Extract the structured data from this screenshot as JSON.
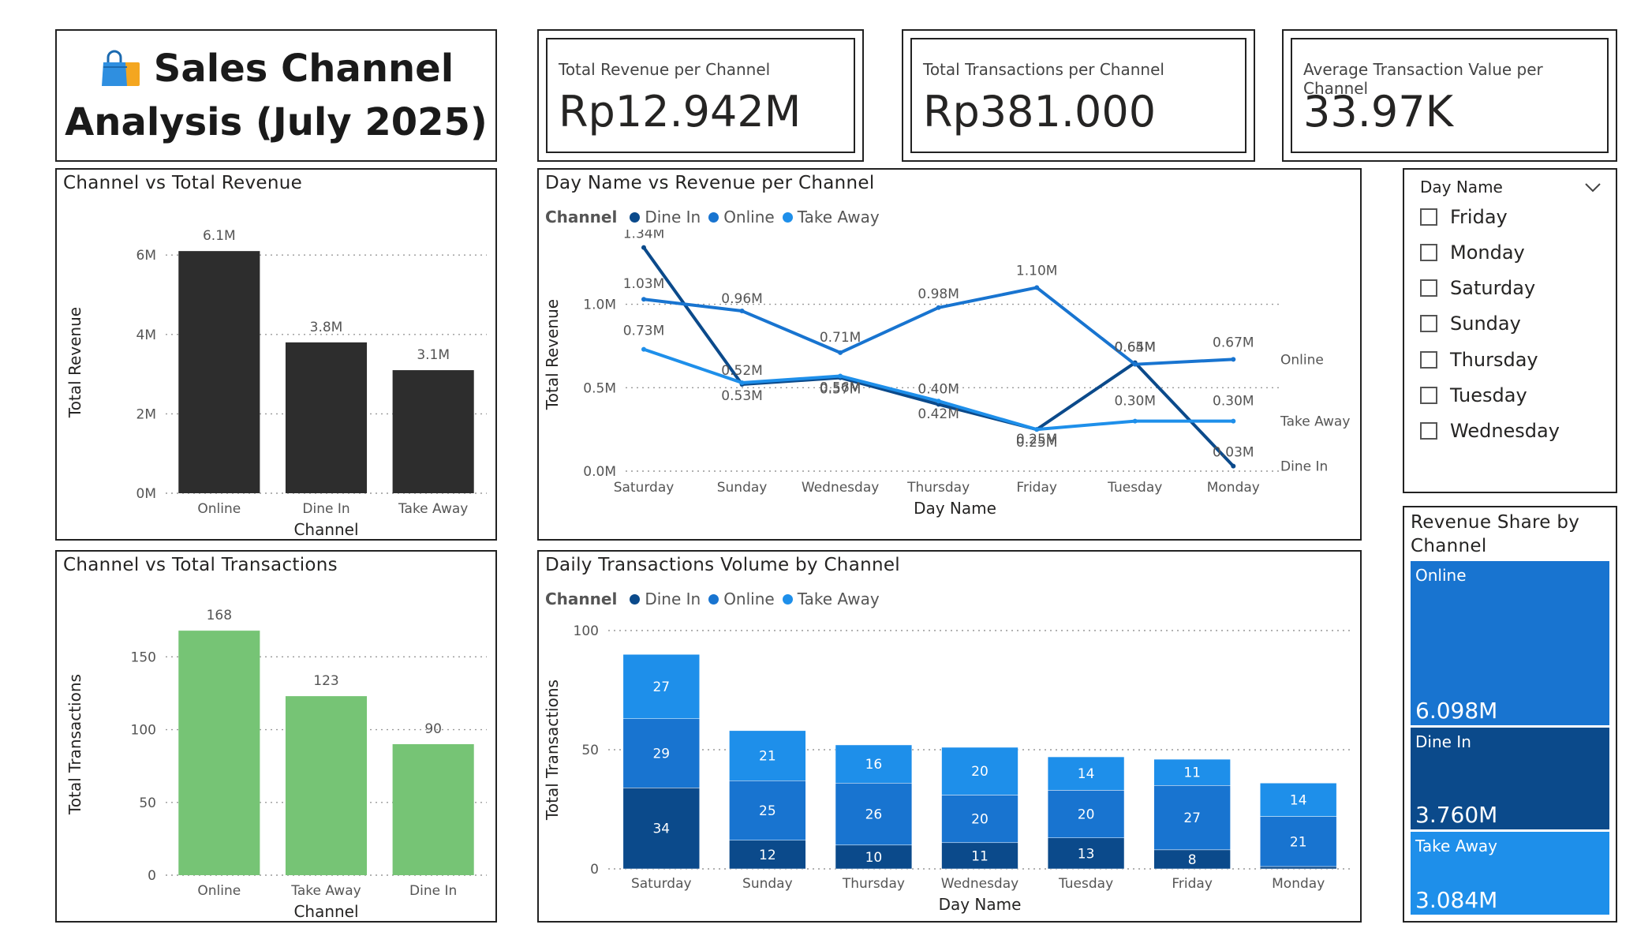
{
  "header": {
    "icon": "shopping-bag-icon",
    "title_line1": "Sales Channel",
    "title_line2": "Analysis (July 2025)"
  },
  "cards": [
    {
      "label": "Total Revenue per Channel",
      "value": "Rp12.942M"
    },
    {
      "label": "Total Transactions per Channel",
      "value": "Rp381.000"
    },
    {
      "label": "Average Transaction Value per Channel",
      "value": "33.97K"
    }
  ],
  "colors": {
    "dine_in": "#0B4A8B",
    "online": "#1874D0",
    "take_away": "#1E8FEA",
    "black_bar": "#2d2d2d",
    "green_bar": "#76C475"
  },
  "slicer": {
    "title": "Day Name",
    "items": [
      "Friday",
      "Monday",
      "Saturday",
      "Sunday",
      "Thursday",
      "Tuesday",
      "Wednesday"
    ]
  },
  "treemap": {
    "title": "Revenue Share by Channel",
    "items": [
      {
        "name": "Online",
        "value": "6.098M",
        "amount": 6.098
      },
      {
        "name": "Dine In",
        "value": "3.760M",
        "amount": 3.76
      },
      {
        "name": "Take Away",
        "value": "3.084M",
        "amount": 3.084
      }
    ]
  },
  "chart_data": [
    {
      "id": "rev",
      "type": "bar",
      "title": "Channel vs Total Revenue",
      "xlabel": "Channel",
      "ylabel": "Total Revenue",
      "categories": [
        "Online",
        "Dine In",
        "Take Away"
      ],
      "values": [
        6.1,
        3.8,
        3.1
      ],
      "data_labels": [
        "6.1M",
        "3.8M",
        "3.1M"
      ],
      "yticks": [
        0,
        2,
        4,
        6
      ],
      "ytick_labels": [
        "0M",
        "2M",
        "4M",
        "6M"
      ],
      "ylim": [
        0,
        6.6
      ],
      "grid": true
    },
    {
      "id": "trx",
      "type": "bar",
      "title": "Channel vs Total Transactions",
      "xlabel": "Channel",
      "ylabel": "Total Transactions",
      "categories": [
        "Online",
        "Take Away",
        "Dine In"
      ],
      "values": [
        168,
        123,
        90
      ],
      "data_labels": [
        "168",
        "123",
        "90"
      ],
      "yticks": [
        0,
        50,
        100,
        150
      ],
      "ytick_labels": [
        "0",
        "50",
        "100",
        "150"
      ],
      "ylim": [
        0,
        180
      ],
      "grid": true
    },
    {
      "id": "line",
      "type": "line",
      "title": "Day Name vs Revenue per Channel",
      "xlabel": "Day Name",
      "ylabel": "Total Revenue",
      "legend_title": "Channel",
      "categories": [
        "Saturday",
        "Sunday",
        "Wednesday",
        "Thursday",
        "Friday",
        "Tuesday",
        "Monday"
      ],
      "yticks": [
        0,
        0.5,
        1.0
      ],
      "ytick_labels": [
        "0.0M",
        "0.5M",
        "1.0M"
      ],
      "ylim": [
        0,
        1.4
      ],
      "series": [
        {
          "name": "Dine In",
          "values": [
            1.34,
            0.52,
            0.56,
            0.4,
            0.25,
            0.65,
            0.03
          ],
          "labels": [
            "1.34M",
            "0.52M",
            "0.56M",
            "0.40M",
            "0.25M",
            "0.65M",
            "0.03M"
          ]
        },
        {
          "name": "Online",
          "values": [
            1.03,
            0.96,
            0.71,
            0.98,
            1.1,
            0.64,
            0.67
          ],
          "labels": [
            "1.03M",
            "0.96M",
            "0.71M",
            "0.98M",
            "1.10M",
            "0.64M",
            "0.67M"
          ]
        },
        {
          "name": "Take Away",
          "values": [
            0.73,
            0.53,
            0.57,
            0.42,
            0.25,
            0.3,
            0.3
          ],
          "labels": [
            "0.73M",
            "0.53M",
            "0.57M",
            "0.42M",
            "0.25M",
            "0.30M",
            "0.30M"
          ]
        }
      ]
    },
    {
      "id": "stack",
      "type": "bar",
      "stacked": true,
      "title": "Daily Transactions Volume by Channel",
      "xlabel": "Day Name",
      "ylabel": "Total Transactions",
      "legend_title": "Channel",
      "categories": [
        "Saturday",
        "Sunday",
        "Thursday",
        "Wednesday",
        "Tuesday",
        "Friday",
        "Monday"
      ],
      "yticks": [
        0,
        50,
        100
      ],
      "ytick_labels": [
        "0",
        "50",
        "100"
      ],
      "ylim": [
        0,
        100
      ],
      "series": [
        {
          "name": "Dine In",
          "values": [
            34,
            12,
            10,
            11,
            13,
            8,
            1
          ],
          "labels": [
            "34",
            "12",
            "10",
            "11",
            "13",
            "8",
            ""
          ]
        },
        {
          "name": "Online",
          "values": [
            29,
            25,
            26,
            20,
            20,
            27,
            21
          ],
          "labels": [
            "29",
            "25",
            "26",
            "20",
            "20",
            "27",
            "21"
          ]
        },
        {
          "name": "Take Away",
          "values": [
            27,
            21,
            16,
            20,
            14,
            11,
            14
          ],
          "labels": [
            "27",
            "21",
            "16",
            "20",
            "14",
            "11",
            "14"
          ]
        }
      ]
    }
  ]
}
